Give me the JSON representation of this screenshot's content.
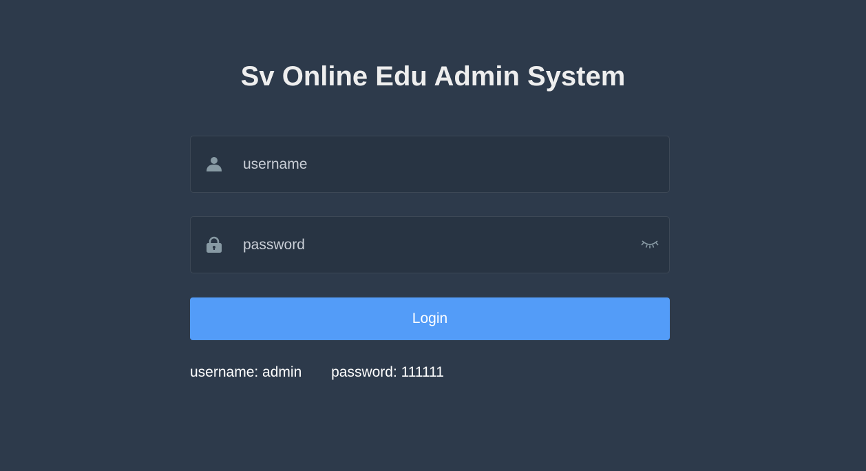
{
  "title": "Sv Online Edu Admin System",
  "form": {
    "username": {
      "placeholder": "username",
      "value": "",
      "icon": "user-icon"
    },
    "password": {
      "placeholder": "password",
      "value": "",
      "icon": "lock-icon",
      "toggle_icon": "eye-closed-icon"
    },
    "login_label": "Login"
  },
  "tips": {
    "username": "username: admin",
    "password": "password: 111111"
  },
  "colors": {
    "background": "#2d3a4b",
    "field_background": "#283443",
    "primary": "#539cf8",
    "icon": "#889aa4"
  }
}
